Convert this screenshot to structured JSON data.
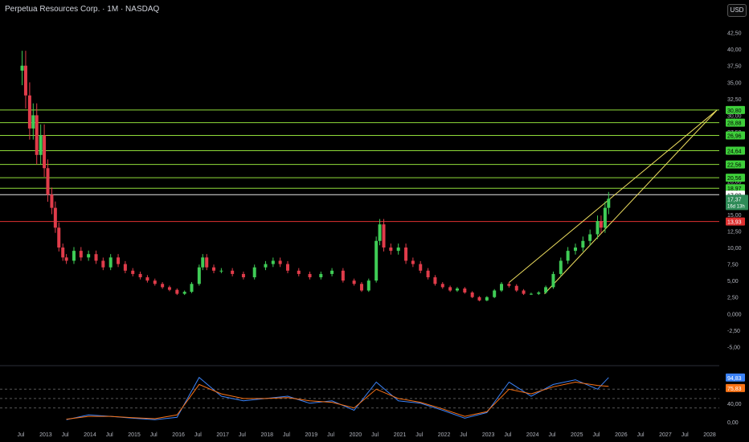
{
  "header": {
    "title": "Perpetua Resources Corp. · 1M · NASDAQ",
    "currency": "USD"
  },
  "colors": {
    "background": "#000000",
    "up": "#3fcc56",
    "down": "#e03c4a",
    "level_line": "#8fdc3a",
    "resistance_red": "#e03030",
    "trend_line": "#f0e060",
    "bollinger": "#2aa566",
    "basis": "#8a2a2a",
    "rsi": "#3b82f6",
    "rsi_ma": "#f97316",
    "axis_text": "#b2b5be"
  },
  "chart_data": [
    {
      "type": "candlestick",
      "title": "Perpetua Resources Corp. · 1M · NASDAQ",
      "ylim": [
        -7.5,
        45
      ],
      "xlim": [
        2012.0,
        2028.25
      ],
      "y_ticks": [
        "-5,00",
        "-2,50",
        "0,000",
        "2,50",
        "5,00",
        "7,50",
        "10,00",
        "12,50",
        "15,00",
        "17,50",
        "20,00",
        "22,50",
        "25,00",
        "27,50",
        "30,00",
        "32,50",
        "35,00",
        "37,50",
        "40,00",
        "42,50"
      ],
      "x_ticks": [
        {
          "t": 2012.5,
          "label": "Jul"
        },
        {
          "t": 2013.0,
          "label": "2013"
        },
        {
          "t": 2013.5,
          "label": "Jul"
        },
        {
          "t": 2014.0,
          "label": "2014"
        },
        {
          "t": 2014.5,
          "label": "Jul"
        },
        {
          "t": 2015.0,
          "label": "2015"
        },
        {
          "t": 2015.5,
          "label": "Jul"
        },
        {
          "t": 2016.0,
          "label": "2016"
        },
        {
          "t": 2016.5,
          "label": "Jul"
        },
        {
          "t": 2017.0,
          "label": "2017"
        },
        {
          "t": 2017.5,
          "label": "Jul"
        },
        {
          "t": 2018.0,
          "label": "2018"
        },
        {
          "t": 2018.5,
          "label": "Jul"
        },
        {
          "t": 2019.0,
          "label": "2019"
        },
        {
          "t": 2019.5,
          "label": "Jul"
        },
        {
          "t": 2020.0,
          "label": "2020"
        },
        {
          "t": 2020.5,
          "label": "Jul"
        },
        {
          "t": 2021.0,
          "label": "2021"
        },
        {
          "t": 2021.5,
          "label": "Jul"
        },
        {
          "t": 2022.0,
          "label": "2022"
        },
        {
          "t": 2022.5,
          "label": "Jul"
        },
        {
          "t": 2023.0,
          "label": "2023"
        },
        {
          "t": 2023.5,
          "label": "Jul"
        },
        {
          "t": 2024.0,
          "label": "2024"
        },
        {
          "t": 2024.5,
          "label": "Jul"
        },
        {
          "t": 2025.0,
          "label": "2025"
        },
        {
          "t": 2025.5,
          "label": "Jul"
        },
        {
          "t": 2026.0,
          "label": "2026"
        },
        {
          "t": 2026.5,
          "label": "Jul"
        },
        {
          "t": 2027.0,
          "label": "2027"
        },
        {
          "t": 2027.5,
          "label": "Jul"
        },
        {
          "t": 2028.0,
          "label": "2028"
        }
      ],
      "price_series": {
        "name": "Close",
        "points": [
          [
            2012.5,
            37.5
          ],
          [
            2012.58,
            33.0
          ],
          [
            2012.67,
            28.0
          ],
          [
            2012.75,
            30.0
          ],
          [
            2012.83,
            24.0
          ],
          [
            2012.92,
            27.0
          ],
          [
            2013.0,
            22.0
          ],
          [
            2013.08,
            18.0
          ],
          [
            2013.17,
            16.0
          ],
          [
            2013.25,
            13.0
          ],
          [
            2013.33,
            10.0
          ],
          [
            2013.42,
            8.5
          ],
          [
            2013.5,
            8.0
          ],
          [
            2013.67,
            9.5
          ],
          [
            2013.83,
            8.5
          ],
          [
            2014.0,
            9.0
          ],
          [
            2014.17,
            8.0
          ],
          [
            2014.33,
            7.0
          ],
          [
            2014.5,
            8.5
          ],
          [
            2014.67,
            7.5
          ],
          [
            2014.83,
            6.5
          ],
          [
            2015.0,
            6.0
          ],
          [
            2015.17,
            5.5
          ],
          [
            2015.33,
            5.0
          ],
          [
            2015.5,
            4.5
          ],
          [
            2015.67,
            4.0
          ],
          [
            2015.83,
            3.6
          ],
          [
            2016.0,
            3.0
          ],
          [
            2016.17,
            3.3
          ],
          [
            2016.33,
            4.5
          ],
          [
            2016.5,
            7.0
          ],
          [
            2016.58,
            8.5
          ],
          [
            2016.67,
            7.0
          ],
          [
            2016.83,
            6.5
          ],
          [
            2017.0,
            6.5
          ],
          [
            2017.25,
            6.0
          ],
          [
            2017.5,
            5.5
          ],
          [
            2017.75,
            7.0
          ],
          [
            2018.0,
            7.5
          ],
          [
            2018.17,
            8.0
          ],
          [
            2018.33,
            7.5
          ],
          [
            2018.5,
            6.5
          ],
          [
            2018.75,
            6.0
          ],
          [
            2019.0,
            5.5
          ],
          [
            2019.25,
            6.0
          ],
          [
            2019.5,
            6.5
          ],
          [
            2019.75,
            5.0
          ],
          [
            2020.0,
            4.5
          ],
          [
            2020.17,
            3.5
          ],
          [
            2020.33,
            5.0
          ],
          [
            2020.5,
            11.0
          ],
          [
            2020.58,
            13.5
          ],
          [
            2020.67,
            10.0
          ],
          [
            2020.83,
            9.5
          ],
          [
            2021.0,
            10.0
          ],
          [
            2021.17,
            8.0
          ],
          [
            2021.33,
            7.5
          ],
          [
            2021.5,
            6.5
          ],
          [
            2021.67,
            5.5
          ],
          [
            2021.83,
            4.5
          ],
          [
            2022.0,
            4.0
          ],
          [
            2022.17,
            3.5
          ],
          [
            2022.33,
            3.8
          ],
          [
            2022.5,
            3.2
          ],
          [
            2022.67,
            2.5
          ],
          [
            2022.83,
            2.0
          ],
          [
            2023.0,
            2.5
          ],
          [
            2023.17,
            3.5
          ],
          [
            2023.33,
            4.5
          ],
          [
            2023.5,
            4.2
          ],
          [
            2023.67,
            3.5
          ],
          [
            2023.83,
            3.0
          ],
          [
            2024.0,
            3.0
          ],
          [
            2024.17,
            3.2
          ],
          [
            2024.33,
            4.0
          ],
          [
            2024.5,
            6.0
          ],
          [
            2024.67,
            8.0
          ],
          [
            2024.83,
            9.5
          ],
          [
            2025.0,
            10.0
          ],
          [
            2025.17,
            11.0
          ],
          [
            2025.33,
            12.0
          ],
          [
            2025.5,
            14.0
          ],
          [
            2025.58,
            13.0
          ],
          [
            2025.67,
            16.0
          ],
          [
            2025.75,
            17.37
          ]
        ]
      },
      "price_levels": [
        {
          "value": 30.8,
          "label": "30,80",
          "kind": "resistance"
        },
        {
          "value": 28.88,
          "label": "28,88",
          "kind": "resistance"
        },
        {
          "value": 26.96,
          "label": "26,96",
          "kind": "resistance"
        },
        {
          "value": 24.64,
          "label": "24,64",
          "kind": "resistance"
        },
        {
          "value": 22.56,
          "label": "22,56",
          "kind": "resistance"
        },
        {
          "value": 20.56,
          "label": "20,56",
          "kind": "resistance"
        },
        {
          "value": 18.97,
          "label": "18,97",
          "kind": "resistance"
        },
        {
          "value": 17.99,
          "label": "17,99",
          "kind": "white"
        },
        {
          "value": 13.93,
          "label": "13,93",
          "kind": "red"
        }
      ],
      "last_price": {
        "value": 17.37,
        "label": "17,37",
        "countdown": "16d 13h"
      },
      "trend_lines": [
        {
          "from": [
            2023.5,
            4.7
          ],
          "to": [
            2028.2,
            30.8
          ]
        },
        {
          "from": [
            2024.3,
            3.0
          ],
          "to": [
            2028.2,
            30.8
          ]
        }
      ]
    },
    {
      "type": "line",
      "title": "",
      "ylim": [
        -5,
        115
      ],
      "y_ticks": [
        "0,00",
        "40,00"
      ],
      "guide_levels": [
        30,
        50,
        70
      ],
      "series": [
        {
          "name": "",
          "values_label": "94,83",
          "points": [
            [
              2013.5,
              5
            ],
            [
              2014.0,
              15
            ],
            [
              2014.5,
              12
            ],
            [
              2015.0,
              8
            ],
            [
              2015.5,
              5
            ],
            [
              2016.0,
              10
            ],
            [
              2016.5,
              95
            ],
            [
              2017.0,
              55
            ],
            [
              2017.5,
              45
            ],
            [
              2018.0,
              50
            ],
            [
              2018.5,
              55
            ],
            [
              2019.0,
              40
            ],
            [
              2019.5,
              45
            ],
            [
              2020.0,
              25
            ],
            [
              2020.5,
              85
            ],
            [
              2021.0,
              45
            ],
            [
              2021.5,
              40
            ],
            [
              2022.0,
              25
            ],
            [
              2022.5,
              8
            ],
            [
              2023.0,
              20
            ],
            [
              2023.5,
              85
            ],
            [
              2024.0,
              55
            ],
            [
              2024.5,
              80
            ],
            [
              2025.0,
              90
            ],
            [
              2025.5,
              70
            ],
            [
              2025.75,
              94.83
            ]
          ]
        },
        {
          "name": "",
          "values_label": "75,83",
          "points": [
            [
              2013.5,
              6
            ],
            [
              2014.0,
              12
            ],
            [
              2014.5,
              12
            ],
            [
              2015.0,
              9
            ],
            [
              2015.5,
              7
            ],
            [
              2016.0,
              15
            ],
            [
              2016.5,
              80
            ],
            [
              2017.0,
              60
            ],
            [
              2017.5,
              50
            ],
            [
              2018.0,
              50
            ],
            [
              2018.5,
              52
            ],
            [
              2019.0,
              45
            ],
            [
              2019.5,
              42
            ],
            [
              2020.0,
              30
            ],
            [
              2020.5,
              70
            ],
            [
              2021.0,
              50
            ],
            [
              2021.5,
              42
            ],
            [
              2022.0,
              28
            ],
            [
              2022.5,
              12
            ],
            [
              2023.0,
              22
            ],
            [
              2023.5,
              70
            ],
            [
              2024.0,
              60
            ],
            [
              2024.5,
              75
            ],
            [
              2025.0,
              85
            ],
            [
              2025.5,
              78
            ],
            [
              2025.75,
              75.83
            ]
          ]
        }
      ]
    }
  ]
}
